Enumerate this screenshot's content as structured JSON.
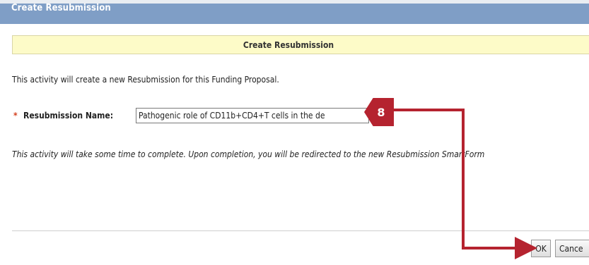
{
  "dialog": {
    "title": "Create Resubmission",
    "form_header": "Create Resubmission",
    "intro_text": "This activity will create a new Resubmission for this Funding Proposal.",
    "required_marker": "*",
    "name_label": "Resubmission Name:",
    "name_value": "Pathogenic role of CD11b+CD4+T cells in the de",
    "info_text": "This activity will take some time to complete.  Upon completion, you will be redirected to the new Resubmission SmartForm",
    "ok_label": "OK",
    "cancel_label": "Cance"
  },
  "annotation": {
    "step_number": "8",
    "color": "#b5232f"
  }
}
